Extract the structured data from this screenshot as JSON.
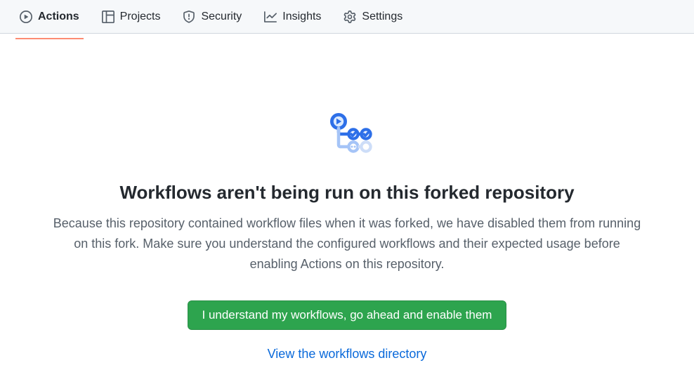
{
  "nav": {
    "tabs": [
      {
        "label": "Actions",
        "icon": "play-icon",
        "selected": true
      },
      {
        "label": "Projects",
        "icon": "table-icon",
        "selected": false
      },
      {
        "label": "Security",
        "icon": "shield-icon",
        "selected": false
      },
      {
        "label": "Insights",
        "icon": "graph-icon",
        "selected": false
      },
      {
        "label": "Settings",
        "icon": "gear-icon",
        "selected": false
      }
    ]
  },
  "blankslate": {
    "headline": "Workflows aren't being run on this forked repository",
    "body": "Because this repository contained workflow files when it was forked, we have disabled them from running on this fork. Make sure you understand the configured workflows and their expected usage before enabling Actions on this repository.",
    "enable_button": "I understand my workflows, go ahead and enable them",
    "view_link": "View the workflows directory"
  }
}
